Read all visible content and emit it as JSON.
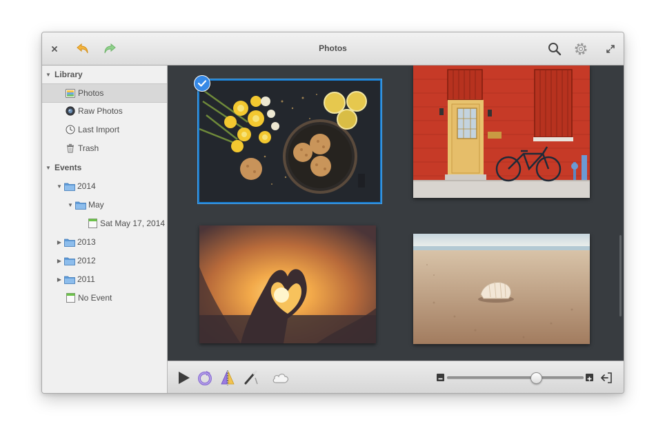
{
  "window": {
    "title": "Photos"
  },
  "sidebar": {
    "library_header": "Library",
    "library_items": [
      {
        "label": "Photos",
        "icon": "photos-icon",
        "selected": true
      },
      {
        "label": "Raw Photos",
        "icon": "camera-icon",
        "selected": false
      },
      {
        "label": "Last Import",
        "icon": "clock-icon",
        "selected": false
      },
      {
        "label": "Trash",
        "icon": "trash-icon",
        "selected": false
      }
    ],
    "events_header": "Events",
    "events": [
      {
        "label": "2014",
        "expanded": true
      },
      {
        "label": "May",
        "expanded": true
      },
      {
        "label": "Sat May 17, 2014"
      },
      {
        "label": "2013",
        "expanded": false
      },
      {
        "label": "2012",
        "expanded": false
      },
      {
        "label": "2011",
        "expanded": false
      },
      {
        "label": "No Event"
      }
    ]
  },
  "photos": [
    {
      "subject": "daffodils-and-cookies",
      "selected": true
    },
    {
      "subject": "red-brick-wall-with-bicycle",
      "selected": false
    },
    {
      "subject": "heart-hands-sunset",
      "selected": false
    },
    {
      "subject": "seashell-on-beach",
      "selected": false
    }
  ],
  "zoom": {
    "level": 0.65
  },
  "colors": {
    "accent": "#3689e6",
    "selection_border": "#1a7fd2",
    "canvas": "#383c40"
  }
}
